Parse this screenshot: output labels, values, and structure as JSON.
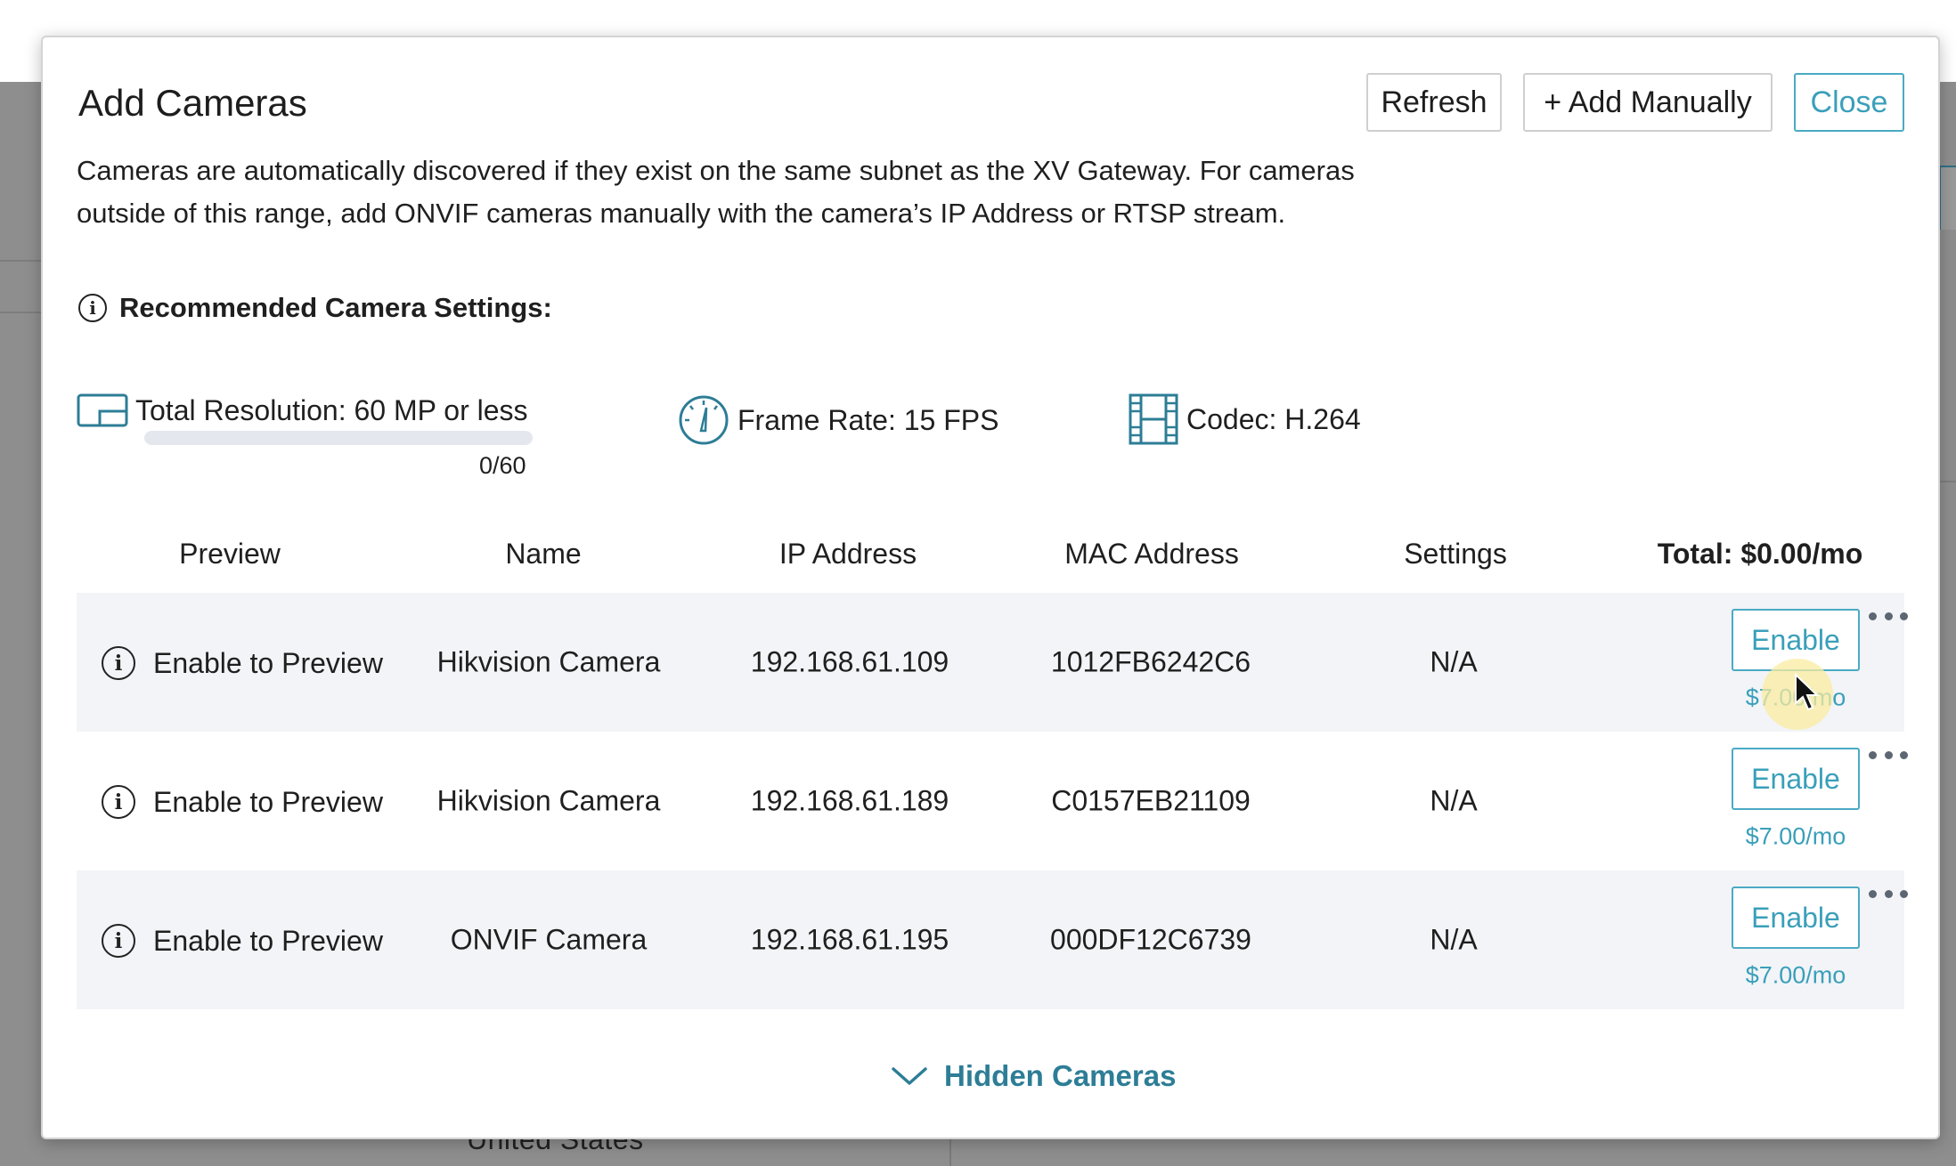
{
  "background": {
    "bottom_text": "United States"
  },
  "modal": {
    "title": "Add Cameras",
    "buttons": {
      "refresh": "Refresh",
      "add_manually": "+ Add Manually",
      "close": "Close"
    },
    "description": "Cameras are automatically discovered if they exist on the same subnet as the XV Gateway. For cameras outside of this range, add ONVIF cameras manually with the camera’s IP Address or RTSP stream.",
    "recommended_title": "Recommended Camera Settings:",
    "settings": {
      "resolution": "Total Resolution: 60 MP or less",
      "frame_rate": "Frame Rate: 15 FPS",
      "codec": "Codec: H.264"
    },
    "resolution_usage": {
      "label": "0/60",
      "used": 0,
      "max": 60
    },
    "table": {
      "headers": {
        "preview": "Preview",
        "name": "Name",
        "ip": "IP Address",
        "mac": "MAC Address",
        "settings": "Settings",
        "total": "Total: $0.00/mo"
      },
      "rows": [
        {
          "preview": "Enable to Preview",
          "name": "Hikvision Camera",
          "ip": "192.168.61.109",
          "mac": "1012FB6242C6",
          "settings": "N/A",
          "action": "Enable",
          "price": "$7.00/mo"
        },
        {
          "preview": "Enable to Preview",
          "name": "Hikvision Camera",
          "ip": "192.168.61.189",
          "mac": "C0157EB21109",
          "settings": "N/A",
          "action": "Enable",
          "price": "$7.00/mo"
        },
        {
          "preview": "Enable to Preview",
          "name": "ONVIF Camera",
          "ip": "192.168.61.195",
          "mac": "000DF12C6739",
          "settings": "N/A",
          "action": "Enable",
          "price": "$7.00/mo"
        }
      ]
    },
    "hidden_cameras": "Hidden Cameras"
  },
  "colors": {
    "accent": "#3a9fba",
    "link": "#2d7d96",
    "row_shade": "#f2f4f7",
    "overlay": "#8e8e8e"
  },
  "icons": {
    "resolution": "screen-resolution-icon",
    "frame_rate": "speedometer-icon",
    "codec": "film-strip-icon",
    "info": "info-circle-icon",
    "more": "more-dots-icon",
    "expand": "chevron-down-icon"
  }
}
